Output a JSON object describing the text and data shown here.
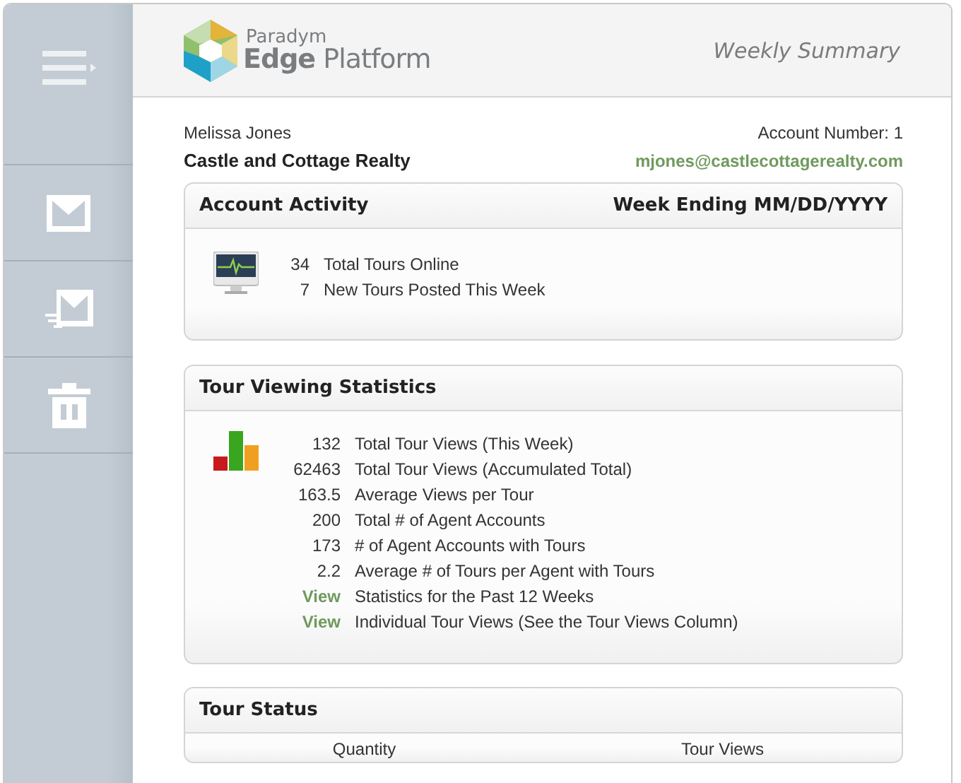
{
  "logo": {
    "brand": "Paradym",
    "product_bold": "Edge",
    "product_light": "Platform"
  },
  "header": {
    "title": "Weekly Summary"
  },
  "sidebar": {
    "items": [
      {
        "kind": "mail"
      },
      {
        "kind": "mail-send"
      },
      {
        "kind": "trash"
      }
    ]
  },
  "account": {
    "name": "Melissa Jones",
    "company": "Castle and Cottage Realty",
    "number": "Account Number: 1",
    "email": "mjones@castlecottagerealty.com"
  },
  "activity": {
    "title": "Account Activity",
    "week": "Week Ending MM/DD/YYYY",
    "rows": [
      {
        "kind": "number",
        "figure": "34",
        "text": "Total Tours Online"
      },
      {
        "kind": "number",
        "figure": "7",
        "text": "New Tours Posted This Week"
      }
    ]
  },
  "statistics": {
    "title": "Tour Viewing Statistics",
    "rows": [
      {
        "kind": "number",
        "figure": "132",
        "text": "Total Tour Views (This Week)"
      },
      {
        "kind": "number",
        "figure": "62463",
        "text": "Total Tour Views (Accumulated Total)"
      },
      {
        "kind": "number",
        "figure": "163.5",
        "text": "Average Views per Tour"
      },
      {
        "kind": "number",
        "figure": "200",
        "text": "Total # of Agent Accounts"
      },
      {
        "kind": "number",
        "figure": "173",
        "text": "# of Agent Accounts with Tours"
      },
      {
        "kind": "number",
        "figure": "2.2",
        "text": "Average # of Tours per Agent with Tours"
      },
      {
        "kind": "link",
        "figure": "View",
        "text": "Statistics for the Past 12 Weeks"
      },
      {
        "kind": "link",
        "figure": "View",
        "text": "Individual Tour Views (See the Tour Views Column)"
      }
    ]
  },
  "tour_status": {
    "title": "Tour Status",
    "columns": [
      "Quantity",
      "Tour Views"
    ]
  }
}
